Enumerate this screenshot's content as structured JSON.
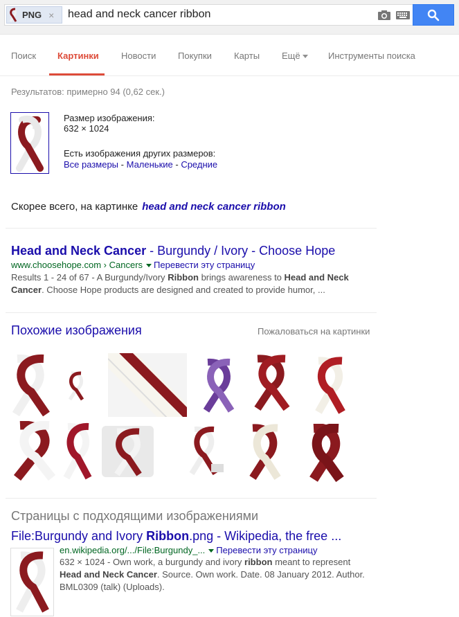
{
  "search": {
    "chip_label": "PNG",
    "chip_close": "×",
    "query": "head and neck cancer ribbon"
  },
  "tabs": [
    {
      "label": "Поиск"
    },
    {
      "label": "Картинки",
      "active": true
    },
    {
      "label": "Новости"
    },
    {
      "label": "Покупки"
    },
    {
      "label": "Карты"
    },
    {
      "label": "Ещё"
    },
    {
      "label": "Инструменты поиска"
    }
  ],
  "stats": "Результатов: примерно 94 (0,62 сек.)",
  "image_info": {
    "size_label": "Размер изображения:",
    "size_value": "632 × 1024",
    "other_sizes_label": "Есть изображения других размеров:",
    "all_sizes": "Все размеры",
    "small": "Маленькие",
    "medium": "Средние",
    "sep": " - "
  },
  "best_guess": {
    "prefix": "Скорее всего, на картинке",
    "link": "head and neck cancer ribbon"
  },
  "result1": {
    "title_bold": "Head and Neck Cancer",
    "title_rest": " - Burgundy / Ivory - Choose Hope",
    "url": "www.choosehope.com › Cancers",
    "translate": "Перевести эту страницу",
    "snippet_1": "Results 1 - 24 of 67 - A Burgundy/Ivory ",
    "snippet_b1": "Ribbon",
    "snippet_2": " brings awareness to ",
    "snippet_b2": "Head and Neck",
    "snippet_b3": "Cancer",
    "snippet_3": ". Choose Hope products are designed and created to provide humor, ..."
  },
  "similar": {
    "heading": "Похожие изображения",
    "report": "Пожаловаться на картинки"
  },
  "pages": {
    "heading": "Страницы с подходящими изображениями"
  },
  "result2": {
    "title_1": "File:Burgundy and Ivory ",
    "title_b": "Ribbon",
    "title_2": ".png - Wikipedia, the free ...",
    "url": "en.wikipedia.org/.../File:Burgundy_...",
    "translate": "Перевести эту страницу",
    "snippet_1": "632 × 1024 - Own work, a burgundy and ivory ",
    "snippet_b1": "ribbon",
    "snippet_2": " meant to represent",
    "snippet_b2": "Head and Neck Cancer",
    "snippet_3": ". Source. Own work. Date. 08 January 2012. Author.",
    "snippet_4": "BML0309 (talk) (Uploads)."
  },
  "colors": {
    "link": "#1a0dab",
    "url_green": "#006621",
    "active_tab": "#dd4b39",
    "search_button": "#4285f4",
    "burgundy": "#8b1a1f",
    "purple": "#6a3d9a"
  }
}
